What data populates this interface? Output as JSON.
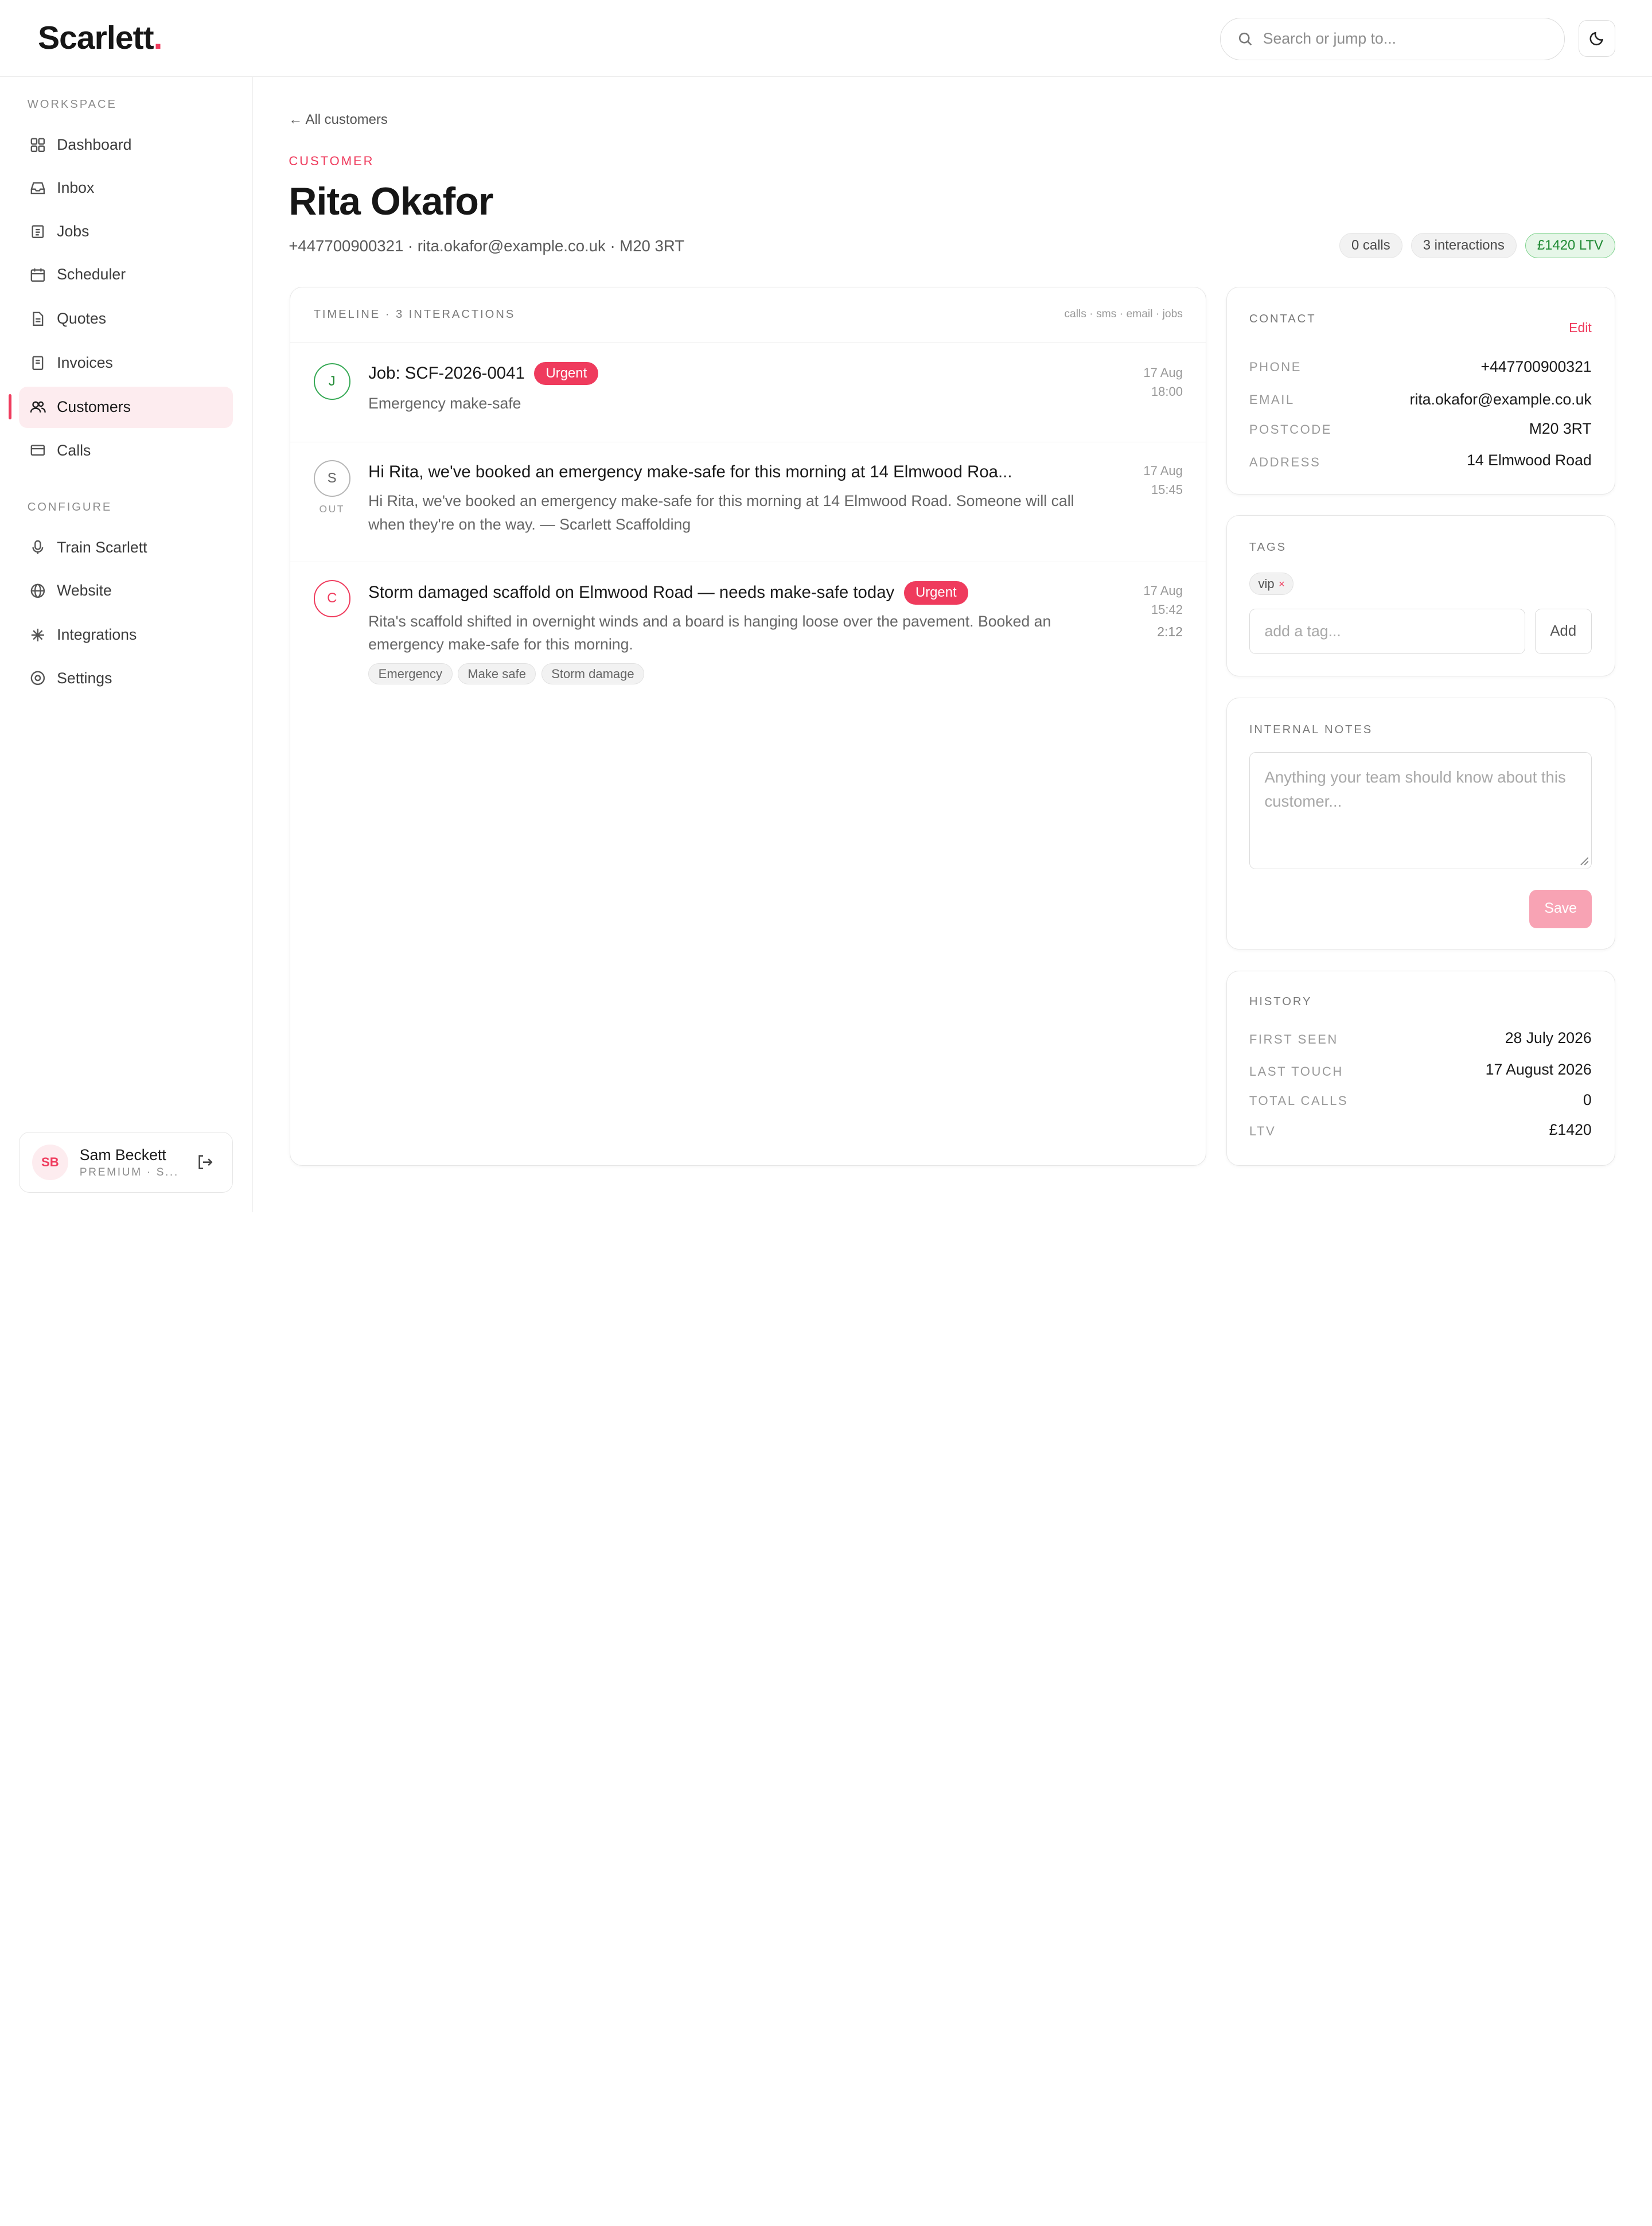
{
  "brand": {
    "name": "Scarlett",
    "dot": "."
  },
  "search": {
    "placeholder": "Search or jump to..."
  },
  "sidebar": {
    "workspace_label": "WORKSPACE",
    "configure_label": "CONFIGURE",
    "workspace_items": [
      {
        "label": "Dashboard",
        "icon": "grid-icon"
      },
      {
        "label": "Inbox",
        "icon": "inbox-icon"
      },
      {
        "label": "Jobs",
        "icon": "clipboard-icon"
      },
      {
        "label": "Scheduler",
        "icon": "calendar-icon"
      },
      {
        "label": "Quotes",
        "icon": "document-icon"
      },
      {
        "label": "Invoices",
        "icon": "receipt-icon"
      },
      {
        "label": "Customers",
        "icon": "users-icon",
        "active": true
      },
      {
        "label": "Calls",
        "icon": "card-icon"
      }
    ],
    "configure_items": [
      {
        "label": "Train Scarlett",
        "icon": "microphone-icon"
      },
      {
        "label": "Website",
        "icon": "globe-icon"
      },
      {
        "label": "Integrations",
        "icon": "sparkle-icon"
      },
      {
        "label": "Settings",
        "icon": "settings-icon"
      }
    ],
    "user": {
      "initials": "SB",
      "name": "Sam Beckett",
      "plan": "PREMIUM · S..."
    }
  },
  "page": {
    "back_label": "← All customers",
    "eyebrow": "CUSTOMER",
    "title": "Rita Okafor",
    "subline": "+447700900321 · rita.okafor@example.co.uk · M20 3RT",
    "pills": {
      "calls": "0 calls",
      "interactions": "3 interactions",
      "ltv": "£1420 LTV"
    }
  },
  "timeline": {
    "label": "TIMELINE · 3 INTERACTIONS",
    "filters": "calls · sms · email · jobs",
    "entries": [
      {
        "initial": "J",
        "title": "Job: SCF-2026-0041",
        "badge": "Urgent",
        "body": "Emergency make-safe",
        "date": "17 Aug",
        "time": "18:00"
      },
      {
        "initial": "S",
        "direction": "OUT",
        "title": "Hi Rita, we've booked an emergency make-safe for this morning at 14 Elmwood Roa...",
        "body": "Hi Rita, we've booked an emergency make-safe for this morning at 14 Elmwood Road. Someone will call when they're on the way. — Scarlett Scaffolding",
        "date": "17 Aug",
        "time": "15:45"
      },
      {
        "initial": "C",
        "title": "Storm damaged scaffold on Elmwood Road — needs make-safe today",
        "badge": "Urgent",
        "body": "Rita's scaffold shifted in overnight winds and a board is hanging loose over the pavement. Booked an emergency make-safe for this morning.",
        "date": "17 Aug",
        "time": "15:42",
        "duration": "2:12",
        "chips": [
          "Emergency",
          "Make safe",
          "Storm damage"
        ]
      }
    ]
  },
  "contact": {
    "label": "CONTACT",
    "edit_label": "Edit",
    "rows": [
      {
        "key": "PHONE",
        "value": "+447700900321"
      },
      {
        "key": "EMAIL",
        "value": "rita.okafor@example.co.uk"
      },
      {
        "key": "POSTCODE",
        "value": "M20 3RT"
      },
      {
        "key": "ADDRESS",
        "value": "14 Elmwood Road"
      }
    ]
  },
  "tags": {
    "label": "TAGS",
    "items": [
      "vip"
    ],
    "remove_glyph": "×",
    "input_placeholder": "add a tag...",
    "add_label": "Add"
  },
  "notes": {
    "label": "INTERNAL NOTES",
    "placeholder": "Anything your team should know about this customer...",
    "save_label": "Save"
  },
  "history": {
    "label": "HISTORY",
    "rows": [
      {
        "key": "FIRST SEEN",
        "value": "28 July 2026"
      },
      {
        "key": "LAST TOUCH",
        "value": "17 August 2026"
      },
      {
        "key": "TOTAL CALLS",
        "value": "0"
      },
      {
        "key": "LTV",
        "value": "£1420"
      }
    ]
  },
  "colors": {
    "accent": "#ef3b5d",
    "success": "#1f8a33",
    "muted": "#8c8c8c"
  }
}
